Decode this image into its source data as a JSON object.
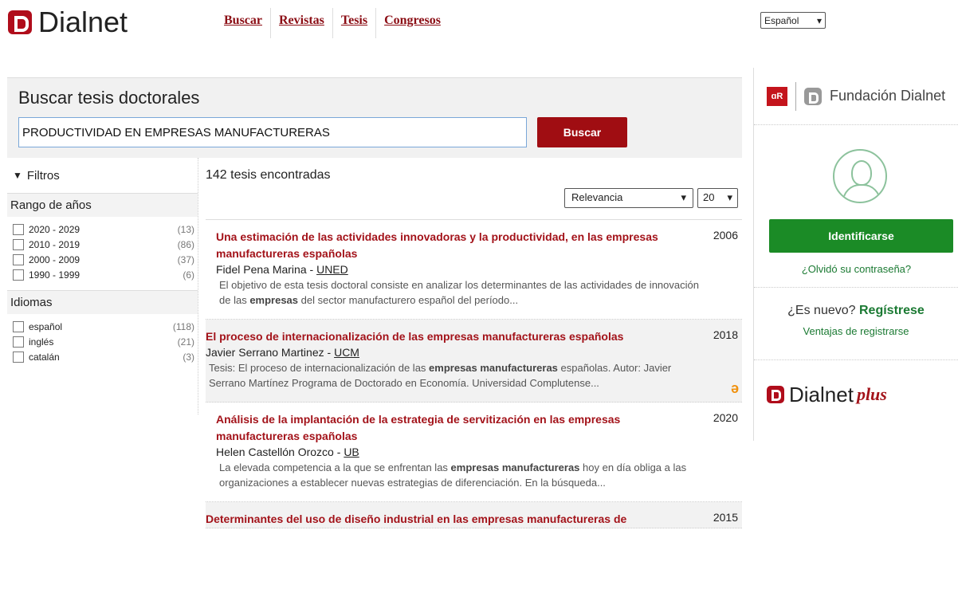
{
  "header": {
    "logo_text": "Dialnet",
    "nav": [
      {
        "label": "Buscar"
      },
      {
        "label": "Revistas"
      },
      {
        "label": "Tesis"
      },
      {
        "label": "Congresos"
      }
    ],
    "language": "Español",
    "language_chevron": "chevron-down-icon"
  },
  "search": {
    "title": "Buscar tesis doctorales",
    "query": "PRODUCTIVIDAD EN EMPRESAS MANUFACTURERAS",
    "button": "Buscar"
  },
  "filters": {
    "header": "Filtros",
    "icon": "funnel-icon",
    "years": {
      "title": "Rango de años",
      "items": [
        {
          "label": "2020 - 2029",
          "count": "(13)"
        },
        {
          "label": "2010 - 2019",
          "count": "(86)"
        },
        {
          "label": "2000 - 2009",
          "count": "(37)"
        },
        {
          "label": "1990 - 1999",
          "count": "(6)"
        }
      ]
    },
    "languages": {
      "title": "Idiomas",
      "items": [
        {
          "label": "español",
          "count": "(118)"
        },
        {
          "label": "inglés",
          "count": "(21)"
        },
        {
          "label": "catalán",
          "count": "(3)"
        }
      ]
    }
  },
  "results": {
    "count_text": "142 tesis encontradas",
    "sort": "Relevancia",
    "per_page": "20",
    "items": [
      {
        "title": "Una estimación de las actividades innovadoras y la productividad, en las empresas manufactureras españolas",
        "year": "2006",
        "author": "Fidel Pena Marina",
        "institution": "UNED",
        "abstract_html": "El objetivo de esta tesis doctoral consiste en analizar los determinantes de las actividades de innovación de las <b>empresas</b> del sector manufacturero español del período..."
      },
      {
        "title": "El proceso de internacionalización de las empresas manufactureras españolas",
        "year": "2018",
        "author": "Javier Serrano Martinez",
        "institution": "UCM",
        "abstract_html": "Tesis: El proceso de internacionalización de las <b>empresas manufactureras</b> españolas. Autor: Javier Serrano Martínez Programa de Doctorado en Economía. Universidad Complutense...",
        "open_access_icon": "open-access-icon"
      },
      {
        "title": "Análisis de la implantación de la estrategia de servitización en las empresas manufactureras españolas",
        "year": "2020",
        "author": "Helen Castellón Orozco",
        "institution": "UB",
        "abstract_html": "La elevada competencia a la que se enfrentan las <b>empresas manufactureras</b> hoy en día obliga a las organizaciones a establecer nuevas estrategias de diferenciación. En la búsqueda..."
      },
      {
        "title": "Determinantes del uso de diseño industrial en las empresas manufactureras de",
        "year": "2015"
      }
    ]
  },
  "sidebar": {
    "fundacion_text": "Fundación Dialnet",
    "uv_logo_text": "ɑR",
    "login_button": "Identificarse",
    "forgot": "¿Olvidó su contraseña?",
    "new_question": "¿Es nuevo?",
    "register": "Regístrese",
    "advantages": "Ventajas de registrarse",
    "plus_text": "Dialnet",
    "plus_suffix": "plus"
  }
}
